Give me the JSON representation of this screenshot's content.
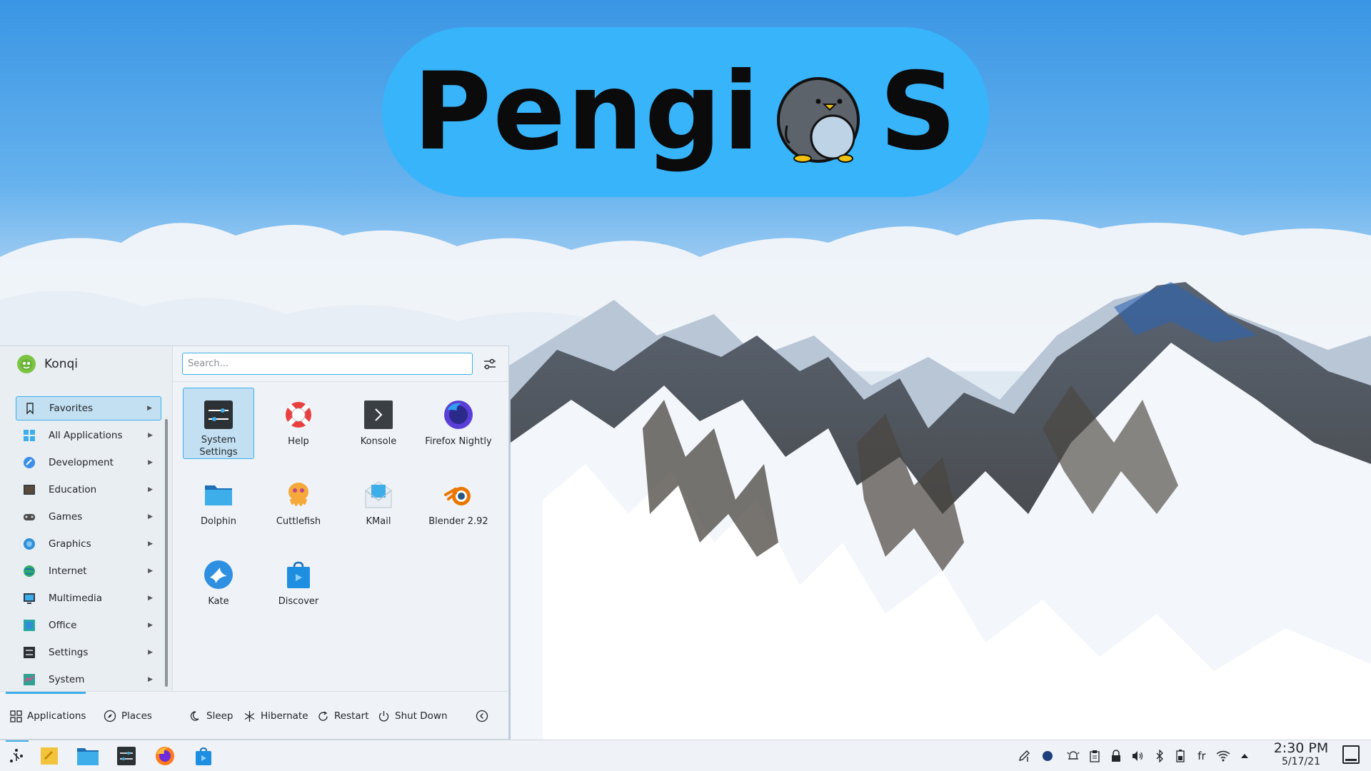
{
  "logo": {
    "text_left": "Pengi",
    "text_right": "S"
  },
  "launcher": {
    "user_name": "Konqi",
    "search_placeholder": "Search...",
    "categories": [
      {
        "label": "Favorites",
        "icon": "bookmark-icon",
        "color": "#ffffff",
        "active": true
      },
      {
        "label": "All Applications",
        "icon": "grid-icon",
        "color": "#3daee9"
      },
      {
        "label": "Development",
        "icon": "development-icon",
        "color": "#3d8ee9"
      },
      {
        "label": "Education",
        "icon": "education-icon",
        "color": "#3a3f44"
      },
      {
        "label": "Games",
        "icon": "gamepad-icon",
        "color": "#4d4d4d"
      },
      {
        "label": "Graphics",
        "icon": "graphics-icon",
        "color": "#2f8fd8"
      },
      {
        "label": "Internet",
        "icon": "globe-icon",
        "color": "#2faa6a"
      },
      {
        "label": "Multimedia",
        "icon": "multimedia-icon",
        "color": "#2f3a4a"
      },
      {
        "label": "Office",
        "icon": "office-icon",
        "color": "#2f8ed8"
      },
      {
        "label": "Settings",
        "icon": "settings-icon",
        "color": "#2c3136"
      },
      {
        "label": "System",
        "icon": "system-icon",
        "color": "#30a090"
      }
    ],
    "apps": [
      {
        "label": "System\nSettings",
        "line1": "System",
        "line2": "Settings",
        "icon": "system-settings-icon",
        "active": true
      },
      {
        "label": "Help",
        "icon": "help-lifebuoy-icon"
      },
      {
        "label": "Konsole",
        "icon": "konsole-icon"
      },
      {
        "label": "Firefox Nightly",
        "icon": "firefox-nightly-icon"
      },
      {
        "label": "Dolphin",
        "icon": "dolphin-folder-icon"
      },
      {
        "label": "Cuttlefish",
        "icon": "cuttlefish-icon"
      },
      {
        "label": "KMail",
        "icon": "kmail-icon"
      },
      {
        "label": "Blender 2.92",
        "icon": "blender-icon"
      },
      {
        "label": "Kate",
        "icon": "kate-icon"
      },
      {
        "label": "Discover",
        "icon": "discover-icon"
      }
    ],
    "footer": {
      "applications": "Applications",
      "places": "Places",
      "sleep": "Sleep",
      "hibernate": "Hibernate",
      "restart": "Restart",
      "shutdown": "Shut Down"
    }
  },
  "taskbar": {
    "tasks": [
      "launcher-icon",
      "notes-icon",
      "dolphin-icon",
      "system-settings-icon",
      "firefox-icon",
      "discover-icon"
    ],
    "keyboard_layout": "fr",
    "time": "2:30 PM",
    "date": "5/17/21"
  },
  "colors": {
    "accent": "#3daee9",
    "logo_bg": "#38b4fb"
  }
}
